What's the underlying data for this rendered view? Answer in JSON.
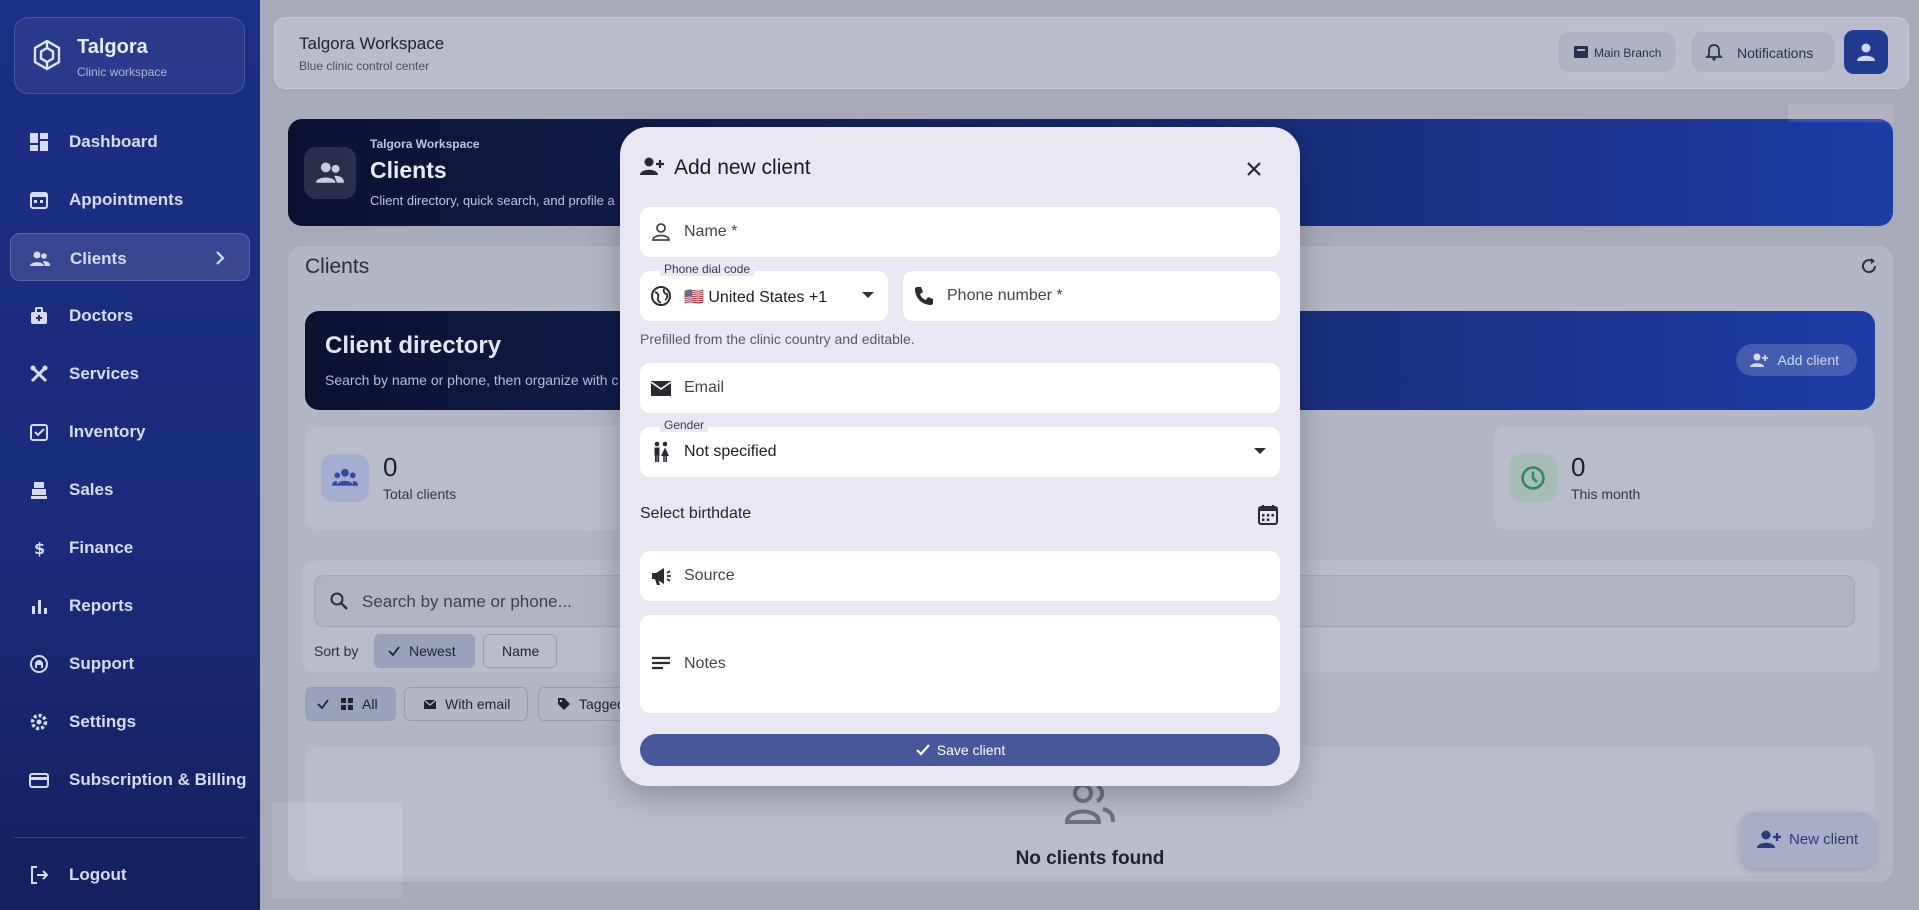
{
  "app": {
    "name": "Talgora",
    "subtitle": "Clinic workspace"
  },
  "sidebar": {
    "items": [
      {
        "label": "Dashboard",
        "icon": "dashboard-icon"
      },
      {
        "label": "Appointments",
        "icon": "calendar-icon"
      },
      {
        "label": "Clients",
        "icon": "people-icon",
        "active": true
      },
      {
        "label": "Doctors",
        "icon": "medical-bag-icon"
      },
      {
        "label": "Services",
        "icon": "tools-icon"
      },
      {
        "label": "Inventory",
        "icon": "inventory-icon"
      },
      {
        "label": "Sales",
        "icon": "register-icon"
      },
      {
        "label": "Finance",
        "icon": "dollar-icon"
      },
      {
        "label": "Reports",
        "icon": "bar-chart-icon"
      },
      {
        "label": "Support",
        "icon": "support-icon"
      },
      {
        "label": "Settings",
        "icon": "gear-icon"
      },
      {
        "label": "Subscription & Billing",
        "icon": "credit-card-icon"
      }
    ],
    "logout": "Logout"
  },
  "topbar": {
    "title": "Talgora Workspace",
    "subtitle": "Blue clinic control center",
    "branch": "Main Branch",
    "notifications": "Notifications"
  },
  "hero": {
    "eyebrow": "Talgora Workspace",
    "title": "Clients",
    "subtitle": "Client directory, quick search, and profile a"
  },
  "panel": {
    "title": "Clients",
    "directory_title": "Client directory",
    "directory_subtitle": "Search by name or phone, then organize with c",
    "add_client": "Add client",
    "stats": [
      {
        "value": "0",
        "label": "Total clients"
      },
      {
        "value": "0",
        "label": "This month"
      }
    ],
    "search_placeholder": "Search by name or phone...",
    "sort_label": "Sort by",
    "sort_options": [
      "Newest",
      "Name"
    ],
    "filters": [
      "All",
      "With email",
      "Tagged"
    ],
    "empty_text": "No clients found",
    "fab_label": "New client"
  },
  "modal": {
    "title": "Add new client",
    "name_placeholder": "Name *",
    "dial_code_label": "Phone dial code",
    "dial_code_value": "🇺🇸 United States +1",
    "phone_placeholder": "Phone number *",
    "helper_text": "Prefilled from the clinic country and editable.",
    "email_placeholder": "Email",
    "gender_label": "Gender",
    "gender_value": "Not specified",
    "birthdate_label": "Select birthdate",
    "source_placeholder": "Source",
    "notes_placeholder": "Notes",
    "save_label": "Save client"
  },
  "colors": {
    "sidebar": "#1d2f86",
    "accent": "#46579a",
    "modal_bg": "#e9e7f1"
  }
}
